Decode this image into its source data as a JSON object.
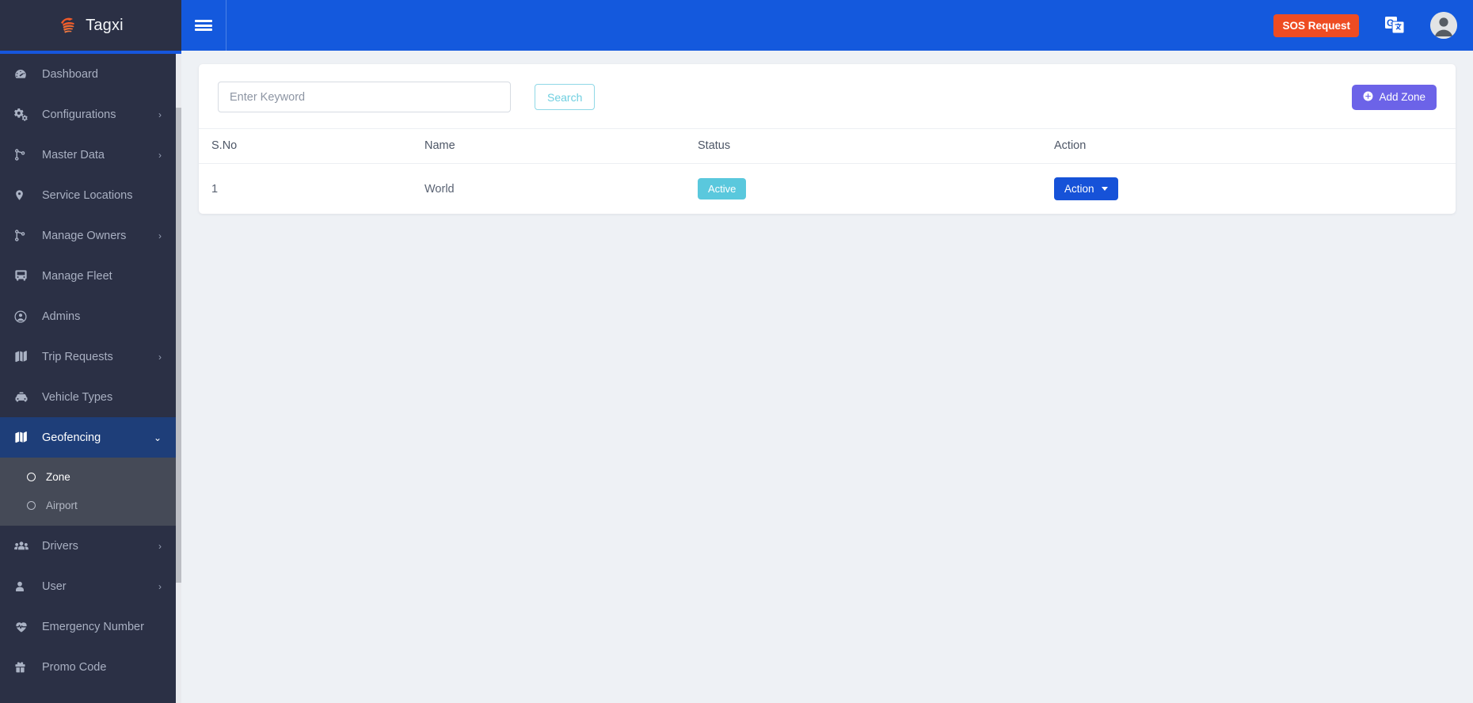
{
  "brand": {
    "name": "Tagxi",
    "logo_icon": "hand-swipe-logo-icon",
    "accent_color": "#1656dd"
  },
  "sidebar": {
    "items": [
      {
        "label": "Dashboard",
        "icon": "dashboard-speedometer-icon",
        "has_caret": false
      },
      {
        "label": "Configurations",
        "icon": "gears-icon",
        "has_caret": true
      },
      {
        "label": "Master Data",
        "icon": "sitemap-icon",
        "has_caret": true
      },
      {
        "label": "Service Locations",
        "icon": "map-pin-icon",
        "has_caret": false
      },
      {
        "label": "Manage Owners",
        "icon": "sitemap-icon",
        "has_caret": true
      },
      {
        "label": "Manage Fleet",
        "icon": "bus-icon",
        "has_caret": false
      },
      {
        "label": "Admins",
        "icon": "user-circle-icon",
        "has_caret": false
      },
      {
        "label": "Trip Requests",
        "icon": "map-icon",
        "has_caret": true
      },
      {
        "label": "Vehicle Types",
        "icon": "taxi-icon",
        "has_caret": false
      },
      {
        "label": "Geofencing",
        "icon": "map-icon",
        "has_caret": true,
        "active": true
      },
      {
        "label": "Drivers",
        "icon": "users-group-icon",
        "has_caret": true
      },
      {
        "label": "User",
        "icon": "user-icon",
        "has_caret": true
      },
      {
        "label": "Emergency Number",
        "icon": "heartbeat-icon",
        "has_caret": false
      },
      {
        "label": "Promo Code",
        "icon": "gift-icon",
        "has_caret": false
      }
    ],
    "submenu": [
      {
        "label": "Zone",
        "selected": true
      },
      {
        "label": "Airport",
        "selected": false
      }
    ],
    "active_color": "#1e3e79",
    "submenu_bg": "#454a57"
  },
  "topbar": {
    "menu_toggle_icon": "hamburger-icon",
    "sos_label": "SOS Request",
    "sos_color": "#ee4c22",
    "translate_icon": "google-translate-icon",
    "avatar_icon": "user-avatar-icon",
    "bg_color": "#1459dd"
  },
  "toolbar": {
    "search_placeholder": "Enter Keyword",
    "search_value": "",
    "search_label": "Search",
    "add_zone_label": "Add Zone",
    "add_zone_icon": "plus-circle-icon",
    "add_zone_color": "#6c63e8"
  },
  "table": {
    "columns": [
      "S.No",
      "Name",
      "Status",
      "Action"
    ],
    "rows": [
      {
        "sno": "1",
        "name": "World",
        "status": "Active",
        "status_color": "#5ac8dd",
        "action_label": "Action",
        "action_icon": "caret-down-icon"
      }
    ]
  }
}
